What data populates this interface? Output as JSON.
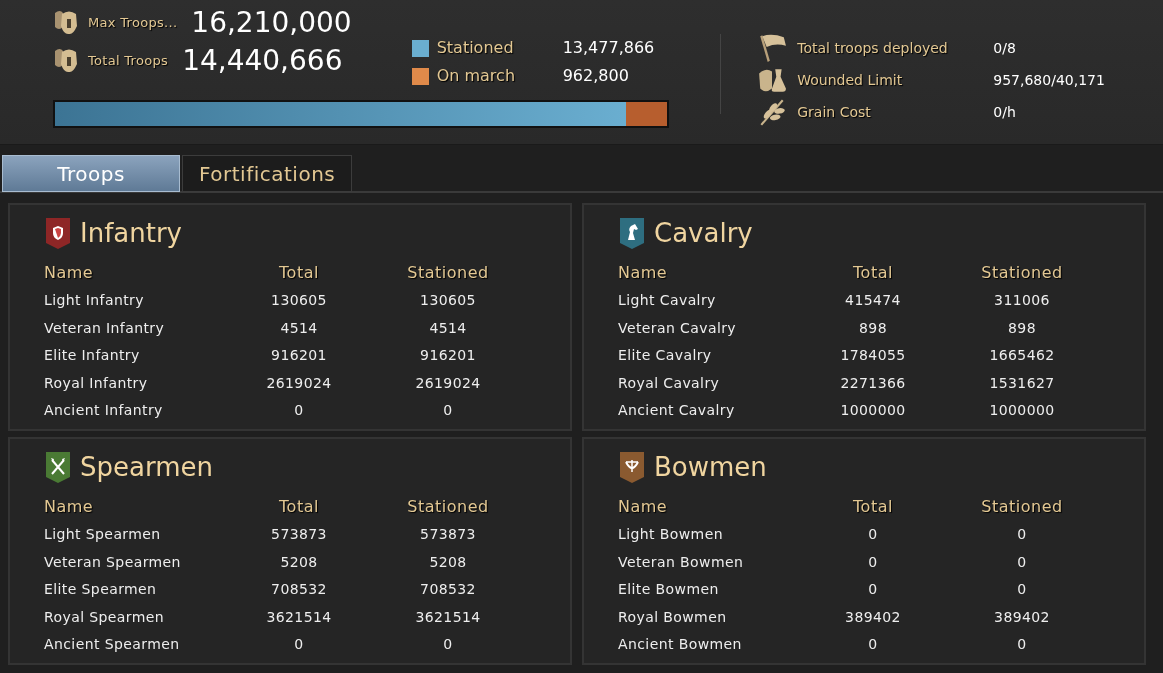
{
  "summary": {
    "max_troops": {
      "label": "Max Troops...",
      "value": "16,210,000"
    },
    "total_troops": {
      "label": "Total Troops",
      "value": "14,440,666"
    },
    "legend": [
      {
        "label": "Stationed",
        "value": "13,477,866",
        "color": "#6aaed0"
      },
      {
        "label": "On march",
        "value": "962,800",
        "color": "#e08a4a"
      }
    ],
    "bar": {
      "level": 0.933
    },
    "stats": [
      {
        "kind": "flag",
        "label": "Total troops deployed",
        "value": "0/8"
      },
      {
        "kind": "wounded",
        "label": "Wounded Limit",
        "value": "957,680/40,171"
      },
      {
        "kind": "grain",
        "label": "Grain Cost",
        "value": "0/h"
      }
    ]
  },
  "tabs": [
    {
      "label": "Troops",
      "selected": true
    },
    {
      "label": "Fortifications",
      "selected": false
    }
  ],
  "panels": [
    {
      "title": "Infantry",
      "kind": "shield",
      "color": "#8e2626",
      "columns": [
        "Name",
        "Total",
        "Stationed"
      ],
      "rows": [
        [
          "Light Infantry",
          "130605",
          "130605"
        ],
        [
          "Veteran Infantry",
          "4514",
          "4514"
        ],
        [
          "Elite Infantry",
          "916201",
          "916201"
        ],
        [
          "Royal Infantry",
          "2619024",
          "2619024"
        ],
        [
          "Ancient Infantry",
          "0",
          "0"
        ]
      ]
    },
    {
      "title": "Cavalry",
      "kind": "horse",
      "color": "#2e6e80",
      "columns": [
        "Name",
        "Total",
        "Stationed"
      ],
      "rows": [
        [
          "Light Cavalry",
          "415474",
          "311006"
        ],
        [
          "Veteran Cavalry",
          "898",
          "898"
        ],
        [
          "Elite Cavalry",
          "1784055",
          "1665462"
        ],
        [
          "Royal Cavalry",
          "2271366",
          "1531627"
        ],
        [
          "Ancient Cavalry",
          "1000000",
          "1000000"
        ]
      ]
    },
    {
      "title": "Spearmen",
      "kind": "spears",
      "color": "#4a7a34",
      "columns": [
        "Name",
        "Total",
        "Stationed"
      ],
      "rows": [
        [
          "Light Spearmen",
          "573873",
          "573873"
        ],
        [
          "Veteran Spearmen",
          "5208",
          "5208"
        ],
        [
          "Elite Spearmen",
          "708532",
          "708532"
        ],
        [
          "Royal Spearmen",
          "3621514",
          "3621514"
        ],
        [
          "Ancient Spearmen",
          "0",
          "0"
        ]
      ]
    },
    {
      "title": "Bowmen",
      "kind": "bow",
      "color": "#8a5a30",
      "columns": [
        "Name",
        "Total",
        "Stationed"
      ],
      "rows": [
        [
          "Light Bowmen",
          "0",
          "0"
        ],
        [
          "Veteran Bowmen",
          "0",
          "0"
        ],
        [
          "Elite Bowmen",
          "0",
          "0"
        ],
        [
          "Royal Bowmen",
          "389402",
          "389402"
        ],
        [
          "Ancient Bowmen",
          "0",
          "0"
        ]
      ]
    }
  ]
}
